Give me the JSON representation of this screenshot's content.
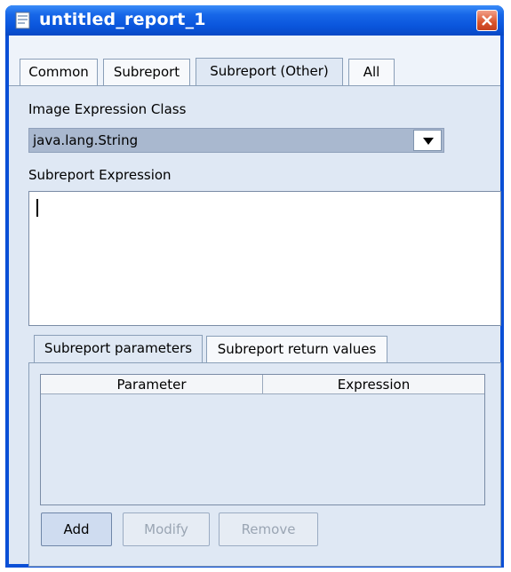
{
  "window": {
    "title": "untitled_report_1",
    "title_icon": "document-icon",
    "close_icon": "close-icon",
    "colors": {
      "titlebar": "#0a55dc",
      "close": "#d9542c",
      "panel": "#dfe8f4"
    }
  },
  "tabs": [
    {
      "label": "Common",
      "active": false
    },
    {
      "label": "Subreport",
      "active": false
    },
    {
      "label": "Subreport (Other)",
      "active": true
    },
    {
      "label": "All",
      "active": false
    }
  ],
  "image_expression_class": {
    "label": "Image Expression Class",
    "value": "java.lang.String"
  },
  "subreport_expression": {
    "label": "Subreport Expression",
    "value": ""
  },
  "subtabs": [
    {
      "label": "Subreport parameters",
      "active": true
    },
    {
      "label": "Subreport return values",
      "active": false
    }
  ],
  "table": {
    "columns": [
      "Parameter",
      "Expression"
    ],
    "rows": []
  },
  "buttons": {
    "add": "Add",
    "modify": "Modify",
    "remove": "Remove"
  }
}
